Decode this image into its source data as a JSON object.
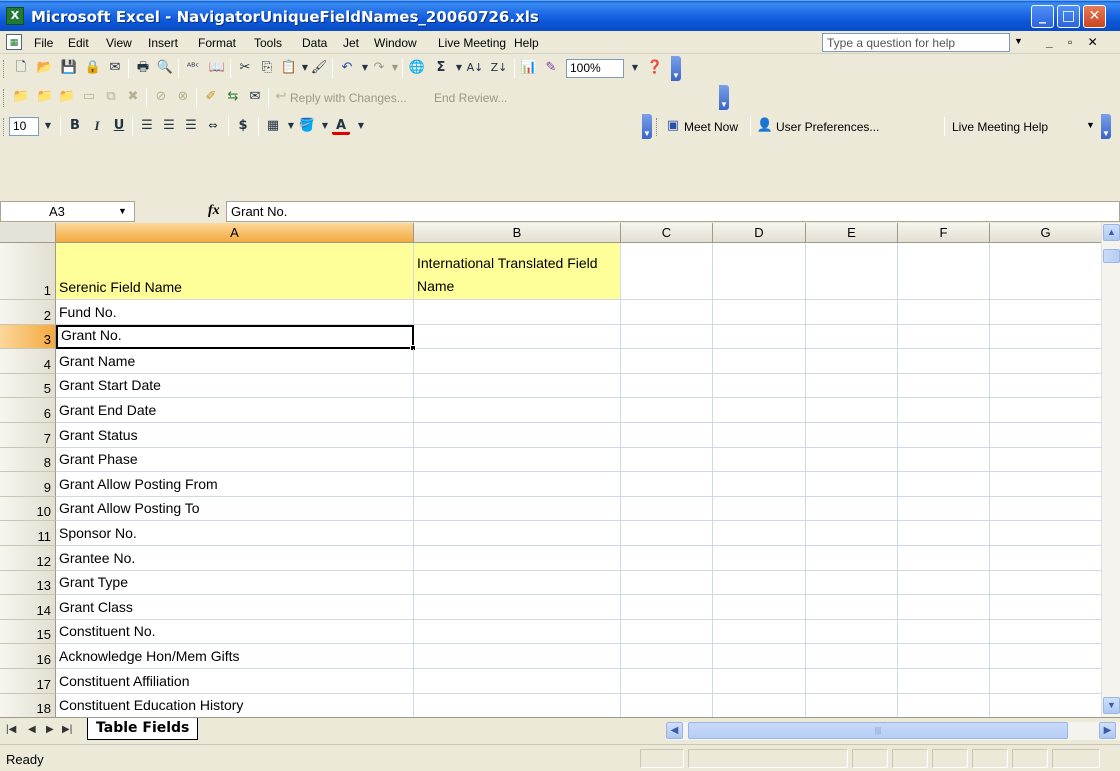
{
  "window": {
    "title": "Microsoft Excel - NavigatorUniqueFieldNames_20060726.xls"
  },
  "menu": {
    "items": [
      "File",
      "Edit",
      "View",
      "Insert",
      "Format",
      "Tools",
      "Data",
      "Jet",
      "Window",
      "Live Meeting",
      "Help"
    ],
    "help_placeholder": "Type a question for help"
  },
  "toolbar": {
    "zoom": "100%",
    "reviewing_reply": "Reply with Changes...",
    "reviewing_end": "End Review...",
    "font_size": "10",
    "currency_symbol": "$",
    "meet_now": "Meet Now",
    "user_prefs": "User Preferences...",
    "live_help": "Live Meeting Help"
  },
  "formula_bar": {
    "name_box": "A3",
    "fx": "fx",
    "value": "Grant No."
  },
  "grid": {
    "columns": [
      "A",
      "B",
      "C",
      "D",
      "E",
      "F",
      "G"
    ],
    "rows": [
      {
        "n": "1",
        "a": "Serenic Field Name",
        "b": "International Translated Field Name"
      },
      {
        "n": "2",
        "a": "Fund No."
      },
      {
        "n": "3",
        "a": "Grant No."
      },
      {
        "n": "4",
        "a": "Grant Name"
      },
      {
        "n": "5",
        "a": "Grant Start Date"
      },
      {
        "n": "6",
        "a": "Grant End Date"
      },
      {
        "n": "7",
        "a": "Grant Status"
      },
      {
        "n": "8",
        "a": "Grant Phase"
      },
      {
        "n": "9",
        "a": "Grant Allow Posting From"
      },
      {
        "n": "10",
        "a": "Grant Allow Posting To"
      },
      {
        "n": "11",
        "a": "Sponsor No."
      },
      {
        "n": "12",
        "a": "Grantee No."
      },
      {
        "n": "13",
        "a": "Grant Type"
      },
      {
        "n": "14",
        "a": "Grant Class"
      },
      {
        "n": "15",
        "a": "Constituent No."
      },
      {
        "n": "16",
        "a": "Acknowledge Hon/Mem Gifts"
      },
      {
        "n": "17",
        "a": "Constituent Affiliation"
      },
      {
        "n": "18",
        "a": "Constituent Education History"
      }
    ]
  },
  "sheets": {
    "active": "Table Fields"
  },
  "status": {
    "text": "Ready"
  }
}
